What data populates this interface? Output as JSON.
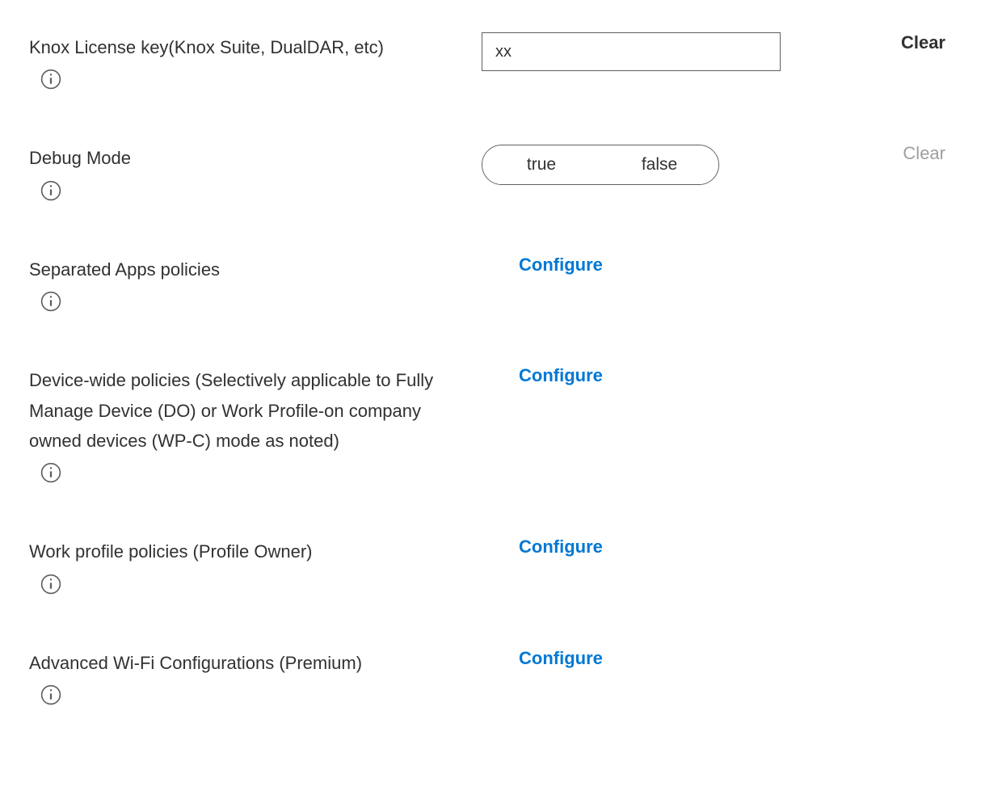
{
  "rows": {
    "knox_license": {
      "label": "Knox License key(Knox Suite, DualDAR, etc)",
      "value": "xx",
      "clear": "Clear"
    },
    "debug_mode": {
      "label": "Debug Mode",
      "option_true": "true",
      "option_false": "false",
      "clear": "Clear"
    },
    "separated_apps": {
      "label": "Separated Apps policies",
      "action": "Configure"
    },
    "device_wide": {
      "label": "Device-wide policies (Selectively applicable to Fully Manage Device (DO) or Work Profile-on company owned devices (WP-C) mode as noted)",
      "action": "Configure"
    },
    "work_profile": {
      "label": "Work profile policies (Profile Owner)",
      "action": "Configure"
    },
    "advanced_wifi": {
      "label": "Advanced Wi-Fi Configurations (Premium)",
      "action": "Configure"
    }
  }
}
